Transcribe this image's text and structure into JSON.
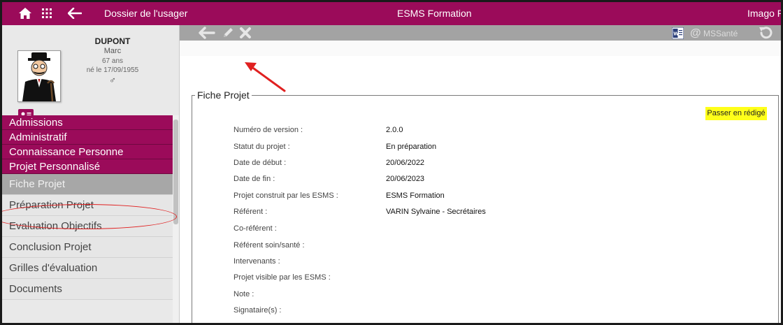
{
  "topbar": {
    "left_title": "Dossier de l'usager",
    "center_title": "ESMS Formation",
    "right_title": "Imago RH"
  },
  "patient": {
    "last_name": "DUPONT",
    "first_name": "Marc",
    "age": "67 ans",
    "birth": "né le 17/09/1955",
    "sex_symbol": "♂"
  },
  "menu": {
    "categories": [
      "Admissions",
      "Administratif",
      "Connaissance Personne",
      "Projet Personnalisé"
    ],
    "items": [
      "Fiche Projet",
      "Préparation Projet",
      "Evaluation Objectifs",
      "Conclusion Projet",
      "Grilles d'évaluation",
      "Documents"
    ],
    "active_item": "Fiche Projet"
  },
  "toolbar": {
    "mssante_at": "@",
    "mssante_label": "MSSanté",
    "icons": [
      "back-arrow-icon",
      "pencil-icon",
      "delete-icon",
      "word-icon",
      "mssante-icon",
      "undo-icon"
    ]
  },
  "fiche": {
    "legend": "Fiche Projet",
    "button": "Passer en rédigé",
    "rows": [
      {
        "label": "Numéro de version :",
        "value": "2.0.0"
      },
      {
        "label": "Statut du projet :",
        "value": "En préparation"
      },
      {
        "label": "Date de début :",
        "value": "20/06/2022"
      },
      {
        "label": "Date de fin :",
        "value": "20/06/2023"
      },
      {
        "label": "Projet construit par les ESMS :",
        "value": "ESMS Formation"
      },
      {
        "label": "Référent :",
        "value": "VARIN Sylvaine - Secrétaires"
      },
      {
        "label": "Co-référent :",
        "value": ""
      },
      {
        "label": "Référent soin/santé :",
        "value": ""
      },
      {
        "label": "Intervenants :",
        "value": ""
      },
      {
        "label": "Projet visible par les ESMS :",
        "value": ""
      },
      {
        "label": "Note :",
        "value": ""
      },
      {
        "label": "Signataire(s) :",
        "value": ""
      }
    ]
  },
  "colors": {
    "brand": "#9b0b5a",
    "highlight_button": "#ffff1a",
    "annotation": "#e02020"
  }
}
